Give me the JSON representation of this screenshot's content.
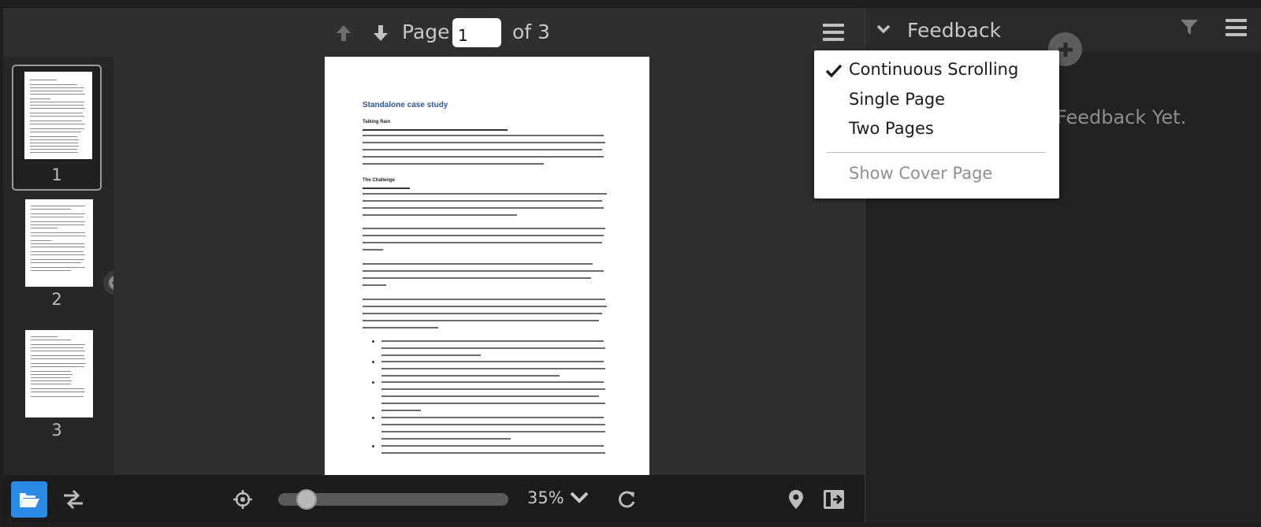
{
  "toolbar": {
    "page_label": "Page",
    "page_value": "1",
    "page_of": "of 3",
    "prev_icon": "arrow-up-icon",
    "next_icon": "arrow-down-icon",
    "menu_icon": "hamburger-icon"
  },
  "thumbnails": [
    {
      "label": "1",
      "active": true
    },
    {
      "label": "2",
      "active": false
    },
    {
      "label": "3",
      "active": false
    }
  ],
  "document": {
    "title": "Standalone case study",
    "heading_1": "Talking Rain",
    "heading_2": "The Challenge"
  },
  "bottom_bar": {
    "zoom_value": "35%",
    "zoom_fraction": 0.35
  },
  "feedback": {
    "title": "Feedback",
    "empty_text": "Feedback Yet."
  },
  "view_menu": {
    "items": [
      {
        "label": "Continuous Scrolling",
        "checked": true,
        "disabled": false
      },
      {
        "label": "Single Page",
        "checked": false,
        "disabled": false
      },
      {
        "label": "Two Pages",
        "checked": false,
        "disabled": false
      }
    ],
    "cover": {
      "label": "Show Cover Page",
      "disabled": true
    }
  },
  "colors": {
    "accent": "#2a8be6",
    "doc_title": "#2f5797"
  }
}
